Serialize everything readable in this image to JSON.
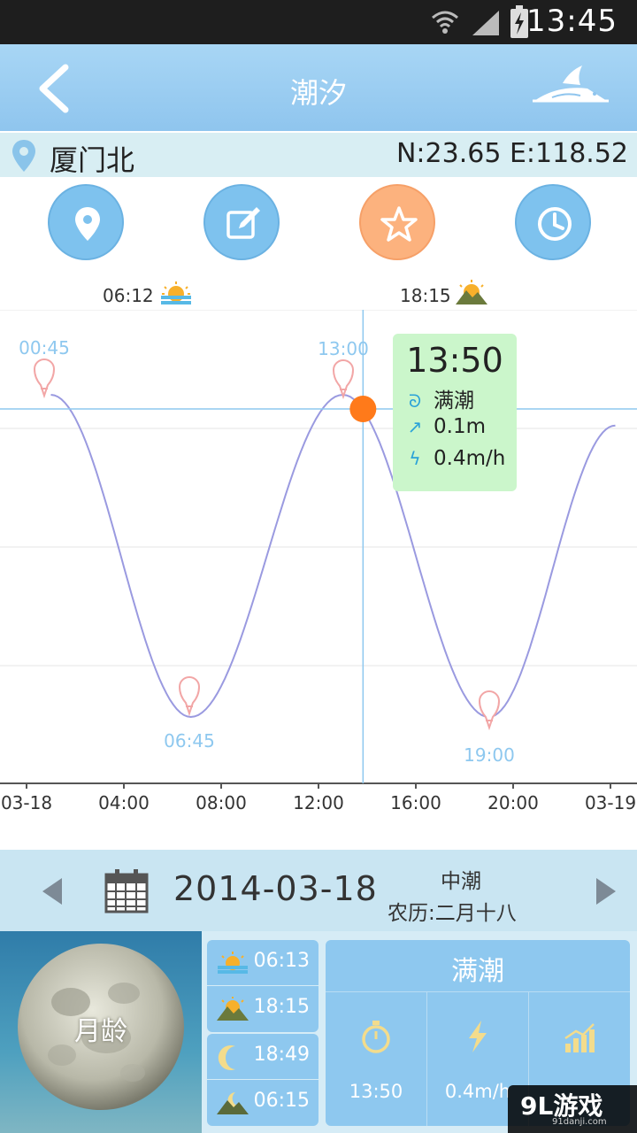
{
  "status_bar": {
    "time": "13:45"
  },
  "header": {
    "title": "潮汐"
  },
  "location": {
    "name": "厦门北",
    "coords": "N:23.65  E:118.52"
  },
  "sun": {
    "sunrise": "06:12",
    "sunset": "18:15"
  },
  "chart_data": {
    "type": "line",
    "x_label_ticks": [
      "03-18",
      "04:00",
      "08:00",
      "12:00",
      "16:00",
      "20:00",
      "03-19"
    ],
    "x_tick_hours": [
      0,
      4,
      8,
      12,
      16,
      20,
      24
    ],
    "series": [
      {
        "values": [
          {
            "hour": 1.0,
            "height": 0.1
          },
          {
            "hour": 6.75,
            "height": -2.0
          },
          {
            "hour": 13.0,
            "height": 0.1
          },
          {
            "hour": 19.0,
            "height": -2.0
          },
          {
            "hour": 24.2,
            "height": -0.1
          }
        ]
      }
    ],
    "extrema": [
      {
        "time": "00:45",
        "type": "high"
      },
      {
        "time": "06:45",
        "type": "low"
      },
      {
        "time": "13:00",
        "type": "high"
      },
      {
        "time": "19:00",
        "type": "low"
      }
    ],
    "cursor_hour": 13.83,
    "grid": true
  },
  "tooltip": {
    "time": "13:50",
    "state": "满潮",
    "height": "0.1m",
    "speed": "0.4m/h"
  },
  "date_bar": {
    "date": "2014-03-18",
    "tide_level": "中潮",
    "lunar": "农历:二月十八"
  },
  "moon": {
    "label": "月龄"
  },
  "sun_card": {
    "sunrise": "06:13",
    "sunset": "18:15"
  },
  "moon_card": {
    "moonrise": "18:49",
    "moonset": "06:15"
  },
  "tide_card": {
    "title": "满潮",
    "time": "13:50",
    "speed": "0.4m/h"
  },
  "watermark": {
    "text": "9L游戏",
    "sub": "91danji.com"
  },
  "colors": {
    "header": "#8fc5ee",
    "accent_orange": "#fcb27e",
    "curve": "#9a9ae0",
    "marker": "#ff7a1a",
    "tooltip_bg": "#cbf6cb"
  }
}
